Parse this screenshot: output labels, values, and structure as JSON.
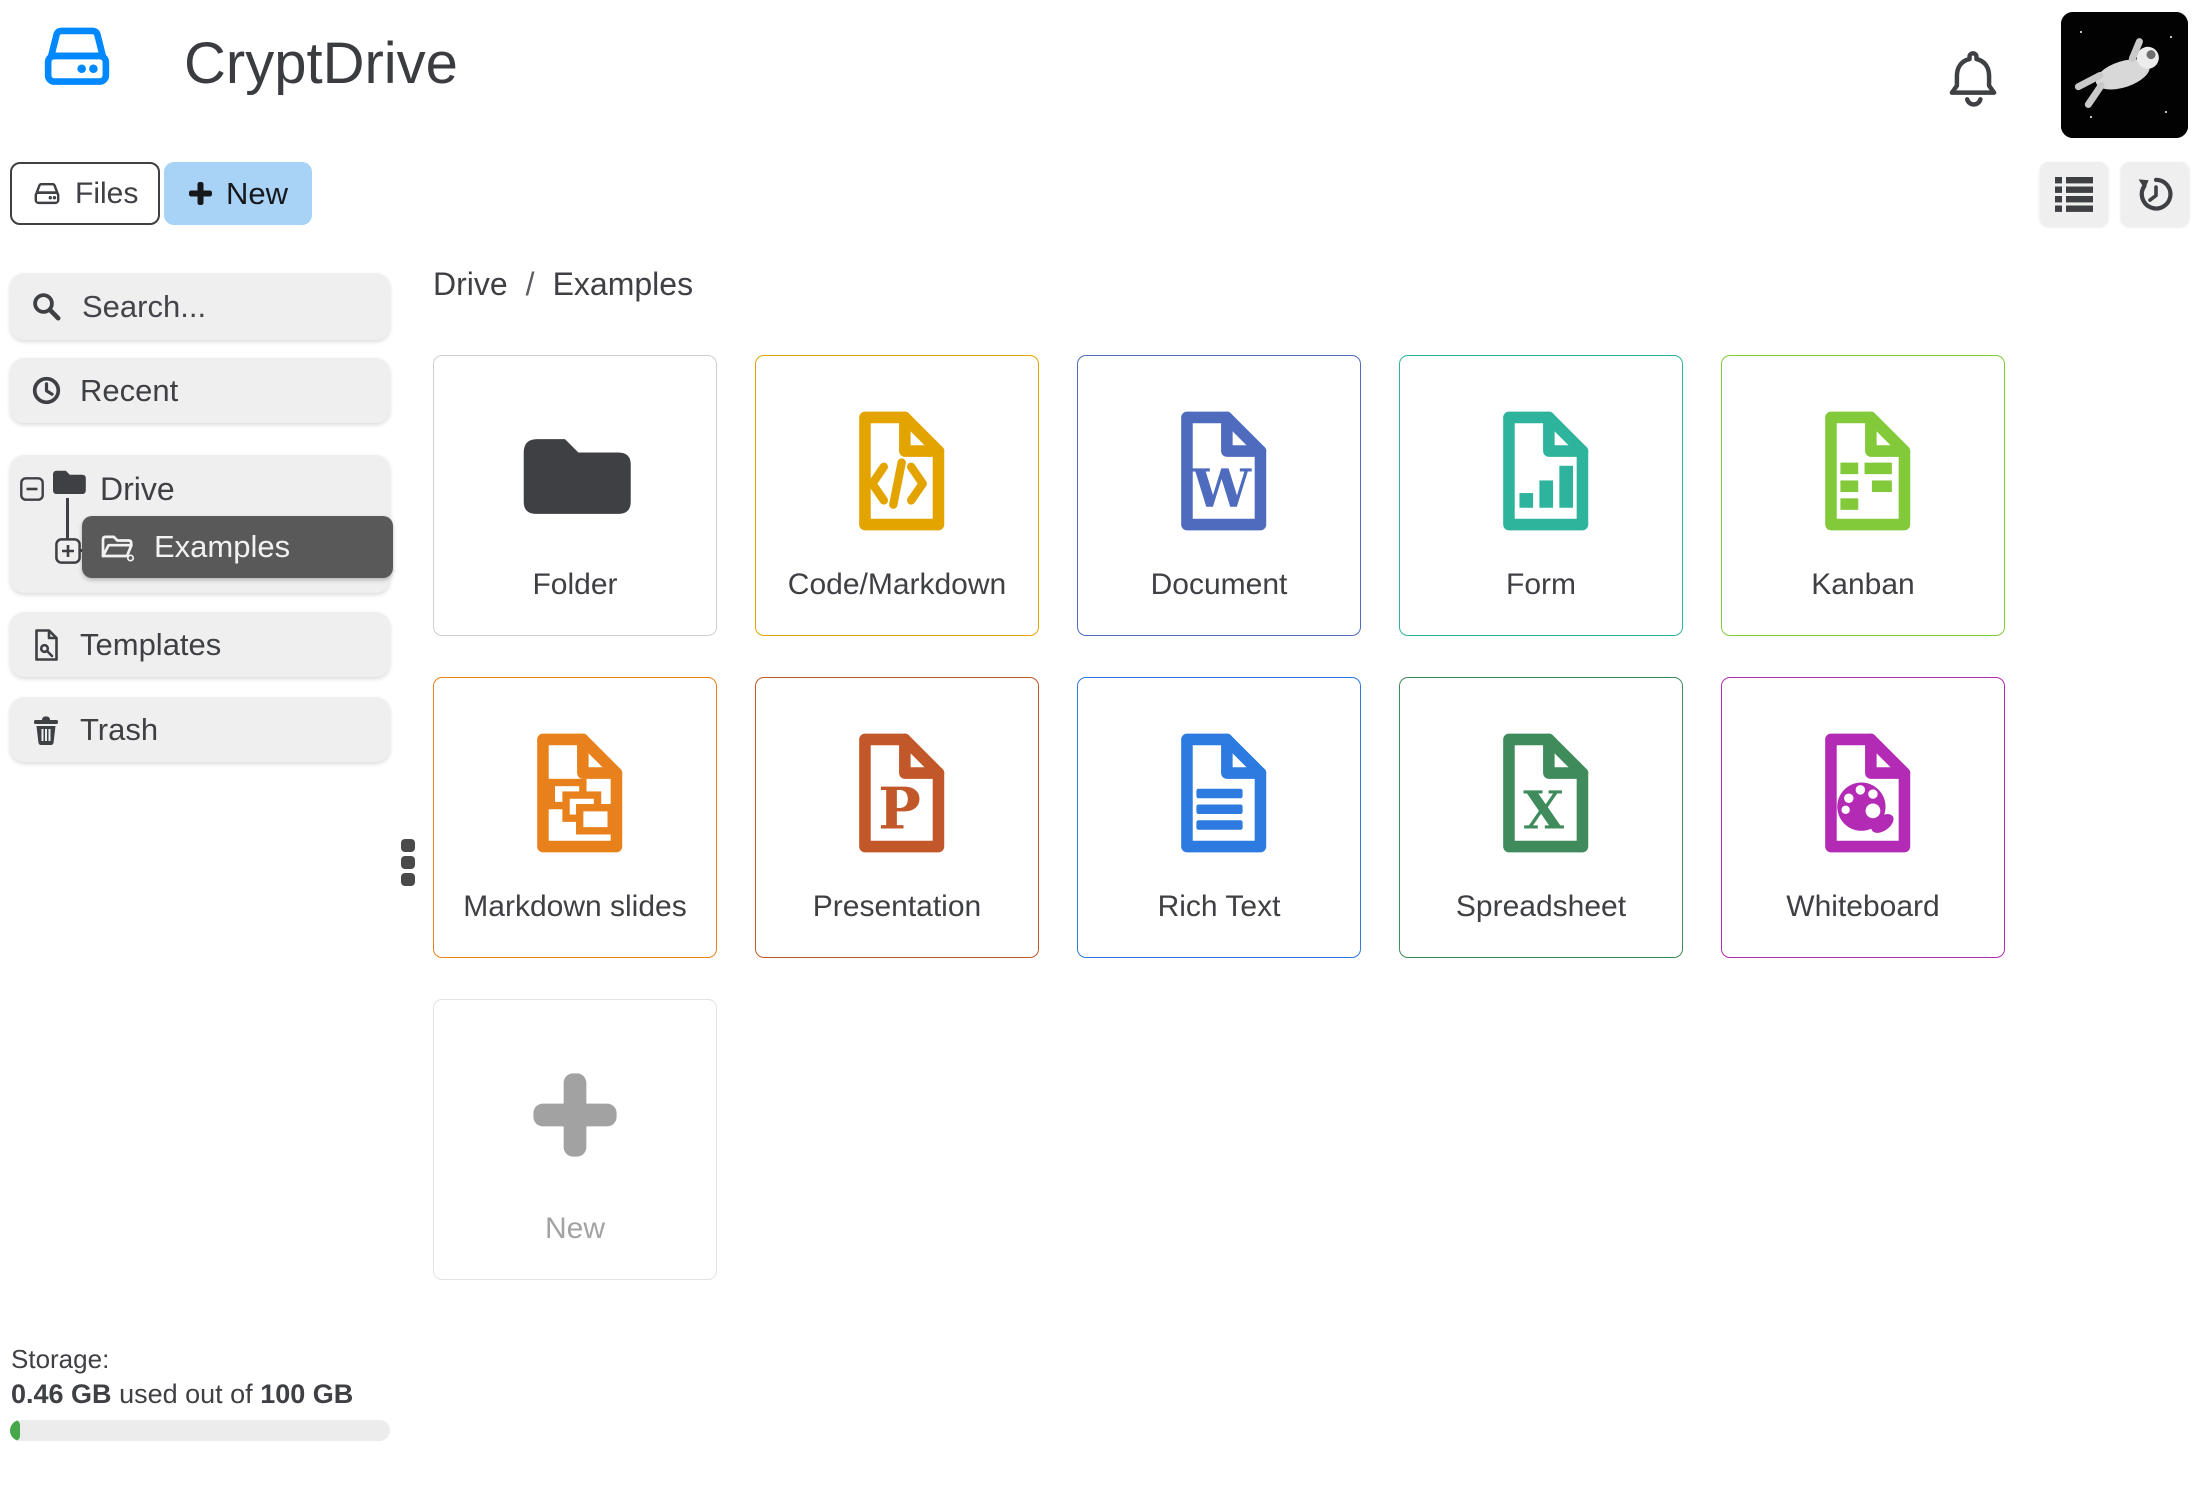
{
  "app": {
    "title": "CryptDrive"
  },
  "toolbar": {
    "files_label": "Files",
    "new_label": "New",
    "icons": [
      "hdd-icon",
      "plus-icon",
      "bell-icon",
      "list-view-icon",
      "history-icon"
    ]
  },
  "breadcrumb": {
    "root": "Drive",
    "separator": "/",
    "current": "Examples"
  },
  "sidebar": {
    "search_placeholder": "Search...",
    "recent_label": "Recent",
    "drive_label": "Drive",
    "examples_label": "Examples",
    "templates_label": "Templates",
    "trash_label": "Trash"
  },
  "storage": {
    "label": "Storage:",
    "used": "0.46 GB",
    "infix": "used out of",
    "total": "100 GB",
    "used_percent": 0.46
  },
  "grid": {
    "new_card_label": "New",
    "items": [
      {
        "label": "Folder",
        "icon": "folder-icon",
        "color": "#3f4044",
        "border": "#cfcfcf"
      },
      {
        "label": "Code/Markdown",
        "icon": "file-code-icon",
        "color": "#e4a400",
        "border": "#e4a400"
      },
      {
        "label": "Document",
        "icon": "file-word-icon",
        "color": "#4f6bbd",
        "border": "#4f6bbd",
        "glyph": "W"
      },
      {
        "label": "Form",
        "icon": "file-form-icon",
        "color": "#2eb49c",
        "border": "#2eb49c"
      },
      {
        "label": "Kanban",
        "icon": "file-kanban-icon",
        "color": "#82ca3a",
        "border": "#82ca3a"
      },
      {
        "label": "Markdown slides",
        "icon": "file-slides-icon",
        "color": "#e8811c",
        "border": "#e8811c"
      },
      {
        "label": "Presentation",
        "icon": "file-presentation-icon",
        "color": "#c2572a",
        "border": "#c2572a",
        "glyph": "P"
      },
      {
        "label": "Rich Text",
        "icon": "file-richtext-icon",
        "color": "#2d7ae0",
        "border": "#2d7ae0"
      },
      {
        "label": "Spreadsheet",
        "icon": "file-spreadsheet-icon",
        "color": "#3f8b5b",
        "border": "#3f8b5b",
        "glyph": "X"
      },
      {
        "label": "Whiteboard",
        "icon": "file-whiteboard-icon",
        "color": "#b32bb5",
        "border": "#b32bb5"
      }
    ]
  },
  "colors": {
    "accent_blue": "#0088fe",
    "new_button_bg": "#a8d2f6",
    "sidebar_bg": "#efefef",
    "selected_item_bg": "#595959",
    "progress_green": "#46a74b",
    "text": "#3f4044"
  }
}
